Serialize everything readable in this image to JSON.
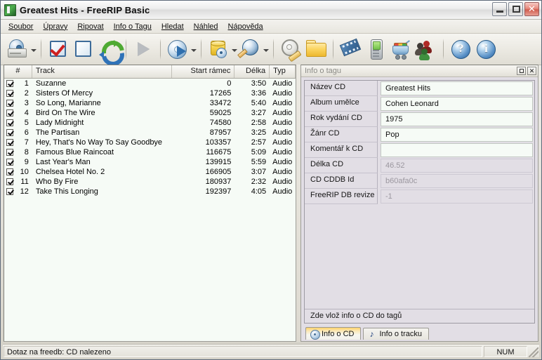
{
  "window": {
    "title": "Greatest Hits - FreeRIP Basic",
    "icon": "app-icon",
    "controls": {
      "minimize": "minimize",
      "maximize": "maximize",
      "close": "✕"
    }
  },
  "menu": {
    "items": [
      {
        "label": "Soubor"
      },
      {
        "label": "Úpravy"
      },
      {
        "label": "Ripovat"
      },
      {
        "label": "Info o Tagu"
      },
      {
        "label": "Hledat"
      },
      {
        "label": "Náhled"
      },
      {
        "label": "Nápověda"
      }
    ]
  },
  "toolbar": {
    "buttons": [
      {
        "name": "cd-drive-icon",
        "dropdown": true
      },
      {
        "name": "select-all-checkbox-icon",
        "dropdown": false
      },
      {
        "name": "deselect-all-checkbox-icon",
        "dropdown": false
      },
      {
        "name": "refresh-icon",
        "dropdown": false
      },
      {
        "name": "rip-play-icon",
        "dropdown": false
      },
      {
        "name": "cd-play-icon",
        "dropdown": true
      },
      {
        "name": "database-icon",
        "dropdown": true
      },
      {
        "name": "search-magnifier-icon",
        "dropdown": true
      },
      {
        "name": "settings-gear-wrench-icon",
        "dropdown": false
      },
      {
        "name": "open-folder-icon",
        "dropdown": false
      },
      {
        "name": "video-film-icon",
        "dropdown": false
      },
      {
        "name": "mobile-phone-icon",
        "dropdown": false
      },
      {
        "name": "shopping-cart-icon",
        "dropdown": false
      },
      {
        "name": "community-people-icon",
        "dropdown": false
      },
      {
        "name": "help-question-icon",
        "dropdown": false
      },
      {
        "name": "about-info-icon",
        "dropdown": false
      }
    ]
  },
  "tracklist": {
    "columns": [
      {
        "key": "num",
        "label": "#"
      },
      {
        "key": "track",
        "label": "Track"
      },
      {
        "key": "start",
        "label": "Start rámec"
      },
      {
        "key": "len",
        "label": "Délka"
      },
      {
        "key": "type",
        "label": "Typ"
      }
    ],
    "rows": [
      {
        "checked": true,
        "num": "1",
        "track": "Suzanne",
        "start": "0",
        "len": "3:50",
        "type": "Audio"
      },
      {
        "checked": true,
        "num": "2",
        "track": "Sisters Of Mercy",
        "start": "17265",
        "len": "3:36",
        "type": "Audio"
      },
      {
        "checked": true,
        "num": "3",
        "track": "So Long, Marianne",
        "start": "33472",
        "len": "5:40",
        "type": "Audio"
      },
      {
        "checked": true,
        "num": "4",
        "track": "Bird On The Wire",
        "start": "59025",
        "len": "3:27",
        "type": "Audio"
      },
      {
        "checked": true,
        "num": "5",
        "track": "Lady Midnight",
        "start": "74580",
        "len": "2:58",
        "type": "Audio"
      },
      {
        "checked": true,
        "num": "6",
        "track": "The Partisan",
        "start": "87957",
        "len": "3:25",
        "type": "Audio"
      },
      {
        "checked": true,
        "num": "7",
        "track": "Hey, That's No Way To Say Goodbye",
        "start": "103357",
        "len": "2:57",
        "type": "Audio"
      },
      {
        "checked": true,
        "num": "8",
        "track": "Famous Blue Raincoat",
        "start": "116675",
        "len": "5:09",
        "type": "Audio"
      },
      {
        "checked": true,
        "num": "9",
        "track": "Last Year's Man",
        "start": "139915",
        "len": "5:59",
        "type": "Audio"
      },
      {
        "checked": true,
        "num": "10",
        "track": "Chelsea Hotel No. 2",
        "start": "166905",
        "len": "3:07",
        "type": "Audio"
      },
      {
        "checked": true,
        "num": "11",
        "track": "Who By Fire",
        "start": "180937",
        "len": "2:32",
        "type": "Audio"
      },
      {
        "checked": true,
        "num": "12",
        "track": "Take This Longing",
        "start": "192397",
        "len": "4:05",
        "type": "Audio"
      }
    ]
  },
  "tagpanel": {
    "title": "Info o tagu",
    "buttons": {
      "maximize": "maximize",
      "close": "✕"
    },
    "fields": [
      {
        "label": "Název CD",
        "value": "Greatest Hits",
        "readonly": false
      },
      {
        "label": "Album umělce",
        "value": "Cohen Leonard",
        "readonly": false
      },
      {
        "label": "Rok vydání CD",
        "value": "1975",
        "readonly": false
      },
      {
        "label": "Žánr CD",
        "value": "Pop",
        "readonly": false
      },
      {
        "label": "Komentář k CD",
        "value": "",
        "readonly": false
      },
      {
        "label": "Délka CD",
        "value": "46.52",
        "readonly": true
      },
      {
        "label": "CD CDDB Id",
        "value": "b60afa0c",
        "readonly": true
      },
      {
        "label": "FreeRIP DB revize",
        "value": "-1",
        "readonly": true
      }
    ],
    "footer": "Zde vlož info o CD do tagů",
    "tabs": [
      {
        "label": "Info o CD",
        "icon": "cd-icon",
        "active": true
      },
      {
        "label": "Info o tracku",
        "icon": "note-icon",
        "active": false
      }
    ]
  },
  "statusbar": {
    "message": "Dotaz na freedb: CD nalezeno",
    "num_indicator": "NUM"
  }
}
